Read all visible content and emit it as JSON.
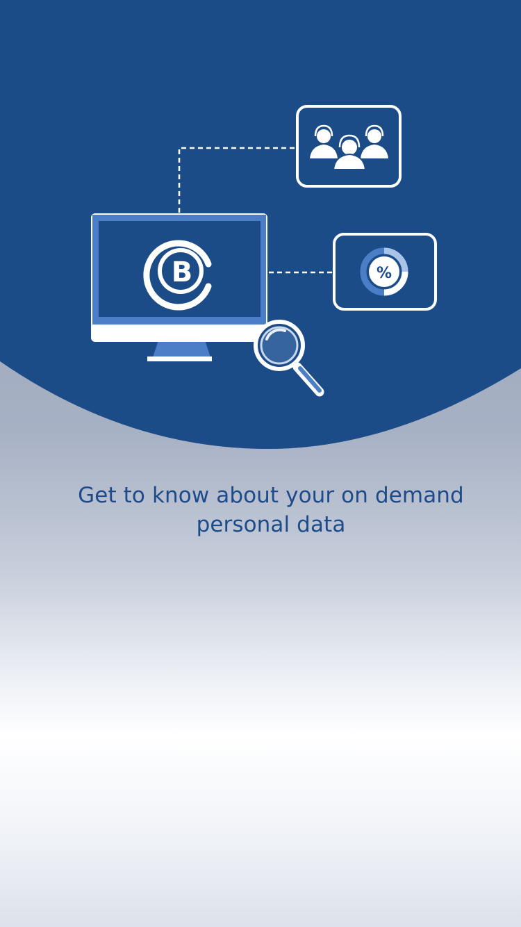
{
  "onboarding": {
    "headline_line1": "Get to know about your on demand",
    "headline_line2": "personal data",
    "logo_text": "B",
    "percent_symbol": "%"
  },
  "colors": {
    "primary_blue": "#1c4c87",
    "headline_text": "#1d4b8a",
    "white": "#ffffff",
    "accent_light_blue": "#4a7fc8"
  },
  "icons": {
    "support_team": "support-team-icon",
    "percentage_chart": "percent-chart-icon",
    "monitor": "monitor-icon",
    "magnifier": "magnifier-icon",
    "logo": "bc-logo-icon"
  }
}
